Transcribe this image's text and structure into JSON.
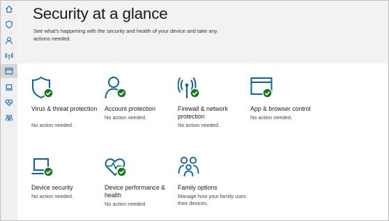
{
  "colors": {
    "accent": "#0063b1",
    "check_bg": "#107c10",
    "sidebar_bg": "#f0f0f0",
    "header_bg": "#f2f2f2"
  },
  "sidebar": {
    "items": [
      {
        "icon": "home-icon"
      },
      {
        "icon": "shield-icon"
      },
      {
        "icon": "person-icon"
      },
      {
        "icon": "wifi-antenna-icon"
      },
      {
        "icon": "app-browser-icon",
        "selected": true
      },
      {
        "icon": "laptop-icon"
      },
      {
        "icon": "heart-icon"
      },
      {
        "icon": "family-icon"
      }
    ]
  },
  "header": {
    "title": "Security at a glance",
    "subtitle": "See what's happening with the security and health of your device and take any actions needed."
  },
  "tiles": [
    {
      "icon": "virus-shield-icon",
      "title": "Virus & threat protection",
      "status": "No action needed."
    },
    {
      "icon": "account-icon",
      "title": "Account protection",
      "status": "No action needed."
    },
    {
      "icon": "firewall-icon",
      "title": "Firewall & network protection",
      "status": "No action needed."
    },
    {
      "icon": "app-browser-icon",
      "title": "App & browser control",
      "status": "No action needed."
    },
    {
      "icon": "device-security-icon",
      "title": "Device security",
      "status": "No action needed."
    },
    {
      "icon": "device-health-icon",
      "title": "Device performance & health",
      "status": "No action needed."
    },
    {
      "icon": "family-options-icon",
      "title": "Family options",
      "status": "Manage how your family uses their devices."
    }
  ]
}
